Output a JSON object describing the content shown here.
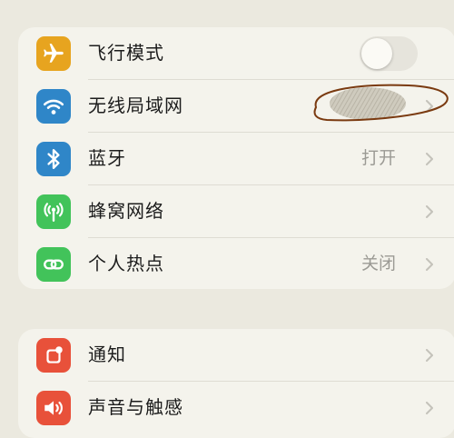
{
  "colors": {
    "airplane": "#e7a41f",
    "wifi": "#2f86c8",
    "bluetooth": "#2f86c8",
    "cellular": "#42c35a",
    "hotspot": "#42c35a",
    "notifications": "#e8513a",
    "sounds": "#e8513a"
  },
  "group1": {
    "rows": [
      {
        "label": "飞行模式",
        "icon": "airplane-icon",
        "toggle_on": false
      },
      {
        "label": "无线局域网",
        "icon": "wifi-icon",
        "value_redacted": true
      },
      {
        "label": "蓝牙",
        "icon": "bluetooth-icon",
        "value": "打开"
      },
      {
        "label": "蜂窝网络",
        "icon": "antenna-icon"
      },
      {
        "label": "个人热点",
        "icon": "link-icon",
        "value": "关闭"
      }
    ]
  },
  "group2": {
    "rows": [
      {
        "label": "通知",
        "icon": "bell-icon"
      },
      {
        "label": "声音与触感",
        "icon": "speaker-icon"
      }
    ]
  }
}
